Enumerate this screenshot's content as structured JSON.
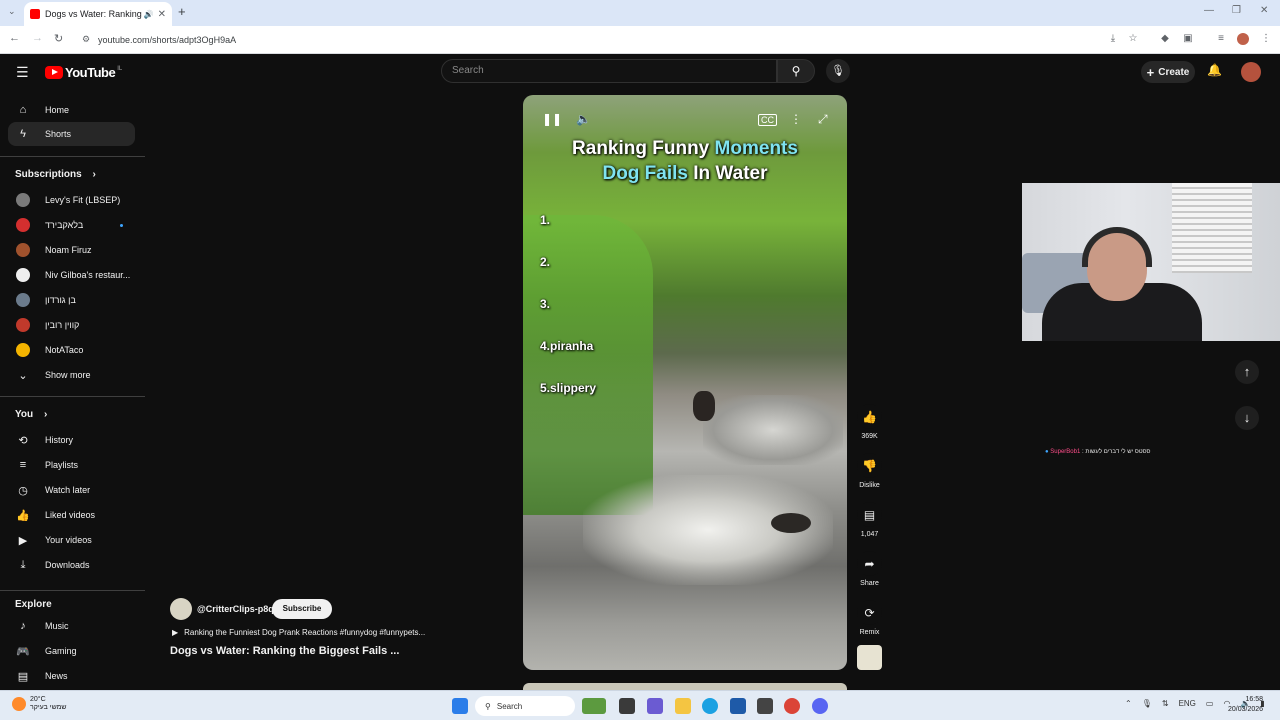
{
  "browser": {
    "tab_title": "Dogs vs Water: Ranking the",
    "url": "youtube.com/shorts/adpt3OgH9aA"
  },
  "header": {
    "logo_text": "YouTube",
    "country_code": "IL",
    "search_placeholder": "Search",
    "create_label": "Create"
  },
  "sidebar": {
    "main": [
      {
        "label": "Home",
        "icon": "home-icon"
      },
      {
        "label": "Shorts",
        "icon": "shorts-icon"
      }
    ],
    "subscriptions_heading": "Subscriptions",
    "subscriptions": [
      {
        "label": "Levy's Fit (LBSEP)",
        "color": "#7a7a7a"
      },
      {
        "label": "בלאקבירד",
        "color": "#d32f2f"
      },
      {
        "label": "Noam Firuz",
        "color": "#a0522d"
      },
      {
        "label": "Niv Gilboa's restaur...",
        "color": "#eeeeee"
      },
      {
        "label": "בן גורדון",
        "color": "#6b7b8c"
      },
      {
        "label": "קווין רובין",
        "color": "#c0392b"
      },
      {
        "label": "NotATaco",
        "color": "#f4b400"
      }
    ],
    "show_more": "Show more",
    "you_heading": "You",
    "you_items": [
      {
        "label": "History",
        "icon": "history-icon"
      },
      {
        "label": "Playlists",
        "icon": "playlists-icon"
      },
      {
        "label": "Watch later",
        "icon": "watch-later-icon"
      },
      {
        "label": "Liked videos",
        "icon": "like-icon"
      },
      {
        "label": "Your videos",
        "icon": "your-videos-icon"
      },
      {
        "label": "Downloads",
        "icon": "download-icon"
      }
    ],
    "explore_heading": "Explore",
    "explore_items": [
      {
        "label": "Music",
        "icon": "music-icon"
      },
      {
        "label": "Gaming",
        "icon": "gaming-icon"
      },
      {
        "label": "News",
        "icon": "news-icon"
      }
    ]
  },
  "video": {
    "title_line1_white": "Ranking Funny",
    "title_line1_blue": "Moments",
    "title_line2_blue": "Dog Fails",
    "title_line2_white": "In Water",
    "ranks": [
      "1.",
      "2.",
      "3.",
      "4.piranha",
      "5.slippery"
    ],
    "actions": [
      {
        "icon": "like-icon",
        "label": "369K"
      },
      {
        "icon": "dislike-icon",
        "label": "Dislike"
      },
      {
        "icon": "comment-icon",
        "label": "1,047"
      },
      {
        "icon": "share-icon",
        "label": "Share"
      },
      {
        "icon": "remix-icon",
        "label": "Remix"
      }
    ],
    "channel": "@CritterClips-p8q",
    "subscribe_label": "Subscribe",
    "sound_text": "Ranking the Funniest Dog Prank Reactions #funnydog #funnypets...",
    "short_title": "Dogs vs Water: Ranking the Biggest Fails ..."
  },
  "overlay": {
    "chat_user": "SuperBob1",
    "chat_text": ": ססטס יש לי דברים לעשות"
  },
  "taskbar": {
    "temperature": "20°C",
    "weather_text": "שמשי בעיקר",
    "search_label": "Search",
    "lang": "ENG",
    "time": "16:58",
    "date": "20/03/2026"
  }
}
